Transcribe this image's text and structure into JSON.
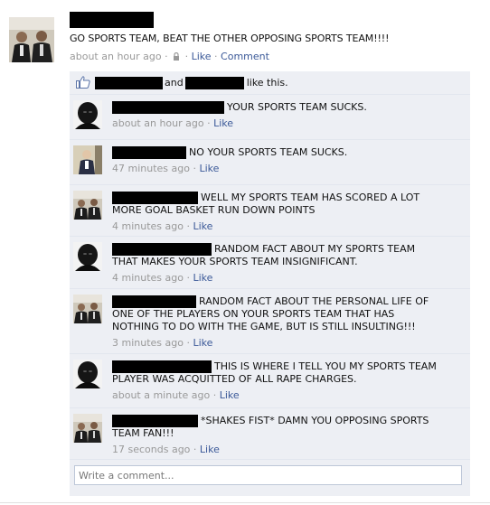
{
  "post": {
    "text": "GO SPORTS TEAM, BEAT THE OTHER OPPOSING SPORTS TEAM!!!!",
    "time": "about an hour ago",
    "sep1": " · ",
    "like_label": "Like",
    "sep2": " · ",
    "comment_label": "Comment"
  },
  "likes": {
    "and": "and",
    "tail": "like this."
  },
  "comments": [
    {
      "lines": [
        "YOUR SPORTS TEAM SUCKS."
      ],
      "time": "about an hour ago",
      "like": "Like"
    },
    {
      "lines": [
        "NO YOUR SPORTS TEAM SUCKS."
      ],
      "time": "47 minutes ago",
      "like": "Like"
    },
    {
      "lines": [
        "WELL MY SPORTS TEAM HAS SCORED A LOT",
        "MORE GOAL BASKET RUN DOWN POINTS"
      ],
      "time": "4 minutes ago",
      "like": "Like"
    },
    {
      "lines": [
        "RANDOM FACT ABOUT MY SPORTS TEAM",
        "THAT MAKES YOUR SPORTS TEAM INSIGNIFICANT."
      ],
      "time": "4 minutes ago",
      "like": "Like"
    },
    {
      "lines": [
        "RANDOM FACT ABOUT THE PERSONAL LIFE OF",
        "ONE OF THE PLAYERS ON YOUR SPORTS TEAM THAT HAS",
        "NOTHING TO DO WITH THE GAME, BUT IS STILL INSULTING!!!"
      ],
      "time": "3 minutes ago",
      "like": "Like"
    },
    {
      "lines": [
        "THIS IS WHERE I TELL YOU MY SPORTS TEAM",
        "PLAYER WAS ACQUITTED OF ALL RAPE CHARGES."
      ],
      "time": "about a minute ago",
      "like": "Like"
    },
    {
      "lines": [
        "*SHAKES FIST* DAMN YOU OPPOSING SPORTS",
        "TEAM FAN!!!"
      ],
      "time": "17 seconds ago",
      "like": "Like"
    }
  ],
  "write_comment": {
    "placeholder": "Write a comment..."
  },
  "colors": {
    "link": "#3b5998",
    "thread_bg": "#edeff4",
    "meta": "#999999"
  },
  "icons": {
    "like": "thumbs-up-icon",
    "privacy": "lock-icon"
  }
}
